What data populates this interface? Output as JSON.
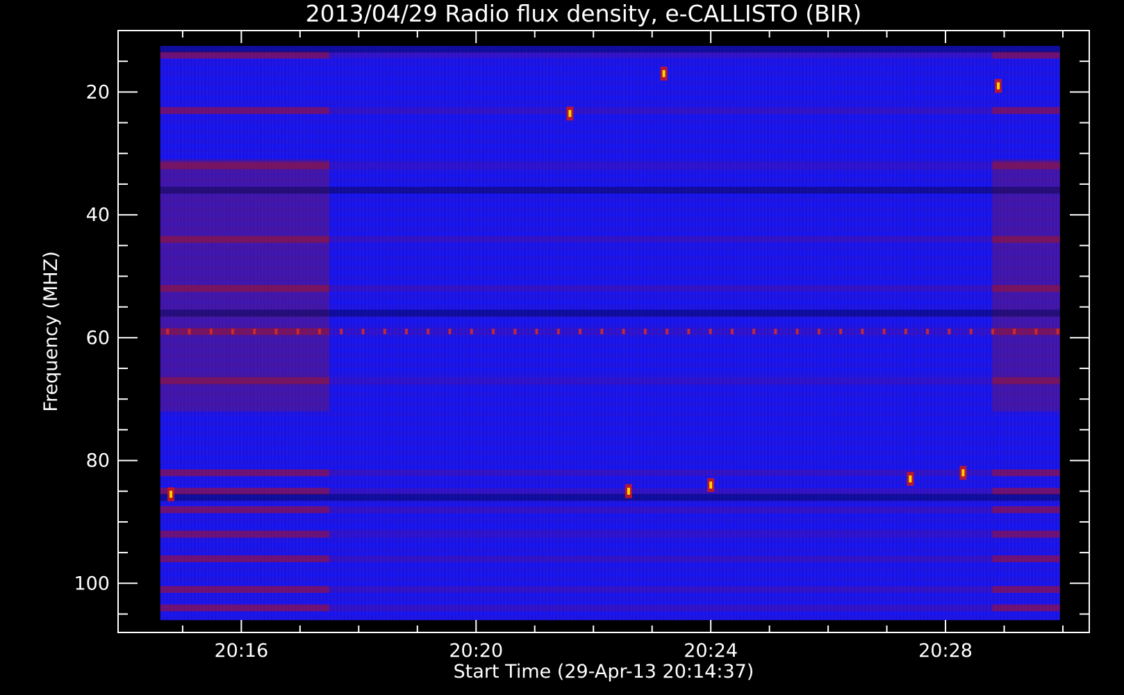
{
  "chart_data": {
    "type": "heatmap",
    "title": "2013/04/29  Radio flux density, e-CALLISTO (BIR)",
    "xlabel": "Start Time (29-Apr-13 20:14:37)",
    "ylabel": "Frequency (MHZ)",
    "x_ticks": [
      "20:16",
      "20:20",
      "20:24",
      "20:28"
    ],
    "x_tick_minutes": [
      16,
      20,
      24,
      28
    ],
    "x_range_minutes": [
      13.9,
      30.45
    ],
    "data_x_range_minutes": [
      14.62,
      29.95
    ],
    "y_ticks": [
      20,
      40,
      60,
      80,
      100
    ],
    "y_range": [
      10,
      108
    ],
    "data_y_range": [
      12.5,
      106
    ],
    "y_inverted": true,
    "quiet_window_minutes": [
      17.5,
      28.8
    ],
    "colormap": [
      "#000000",
      "#0000ff",
      "#cc1100",
      "#ffd700",
      "#ffffff"
    ],
    "background": "#1a16f2",
    "rfi_bands_mhz": [
      14,
      23,
      32,
      44,
      52,
      59,
      67,
      82,
      85,
      88,
      92,
      96,
      101,
      104
    ],
    "dark_bands_mhz": [
      13,
      36,
      56,
      86
    ],
    "bursts": [
      {
        "t_min": 14.8,
        "f_mhz": 85.5
      },
      {
        "t_min": 21.6,
        "f_mhz": 23.5
      },
      {
        "t_min": 23.2,
        "f_mhz": 17
      },
      {
        "t_min": 22.6,
        "f_mhz": 85
      },
      {
        "t_min": 24.0,
        "f_mhz": 84
      },
      {
        "t_min": 27.4,
        "f_mhz": 83
      },
      {
        "t_min": 28.3,
        "f_mhz": 82
      },
      {
        "t_min": 28.9,
        "f_mhz": 19
      }
    ],
    "grid": false,
    "legend": "none"
  }
}
